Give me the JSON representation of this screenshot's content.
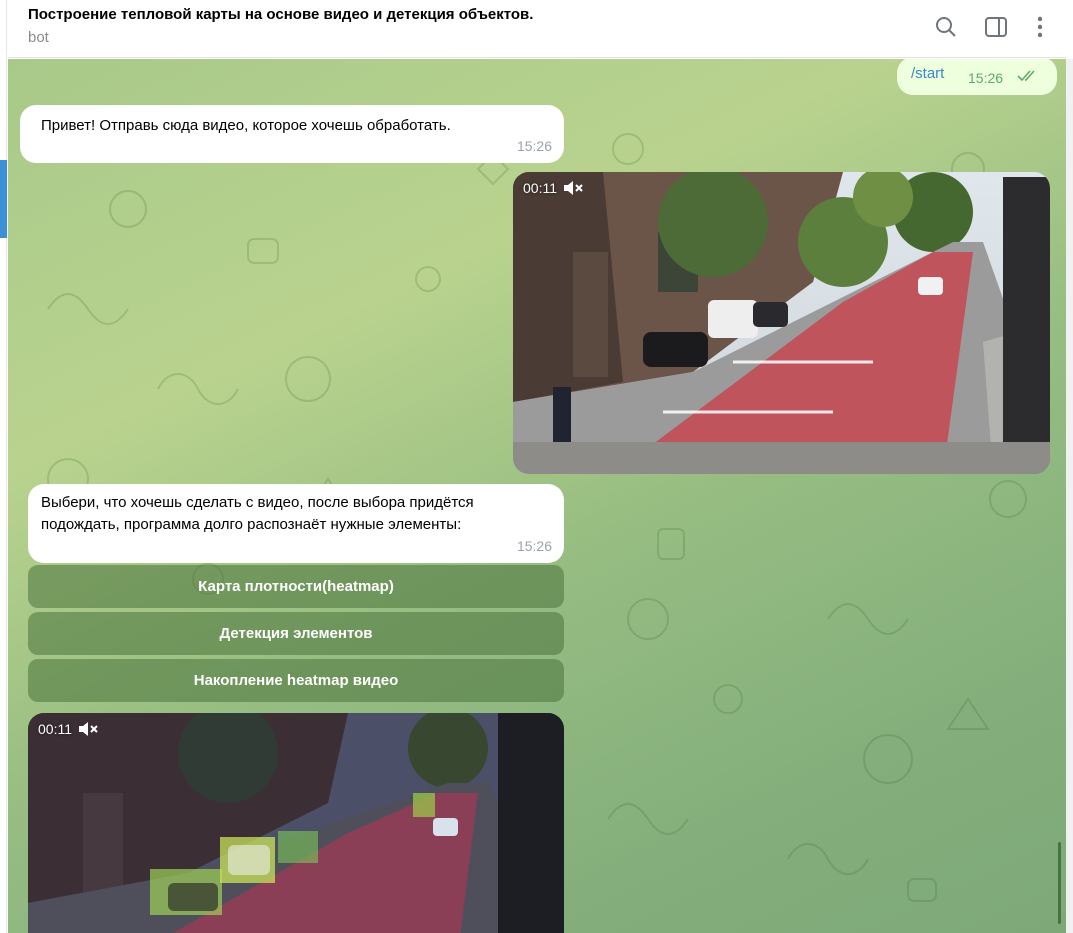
{
  "header": {
    "title": "Построение тепловой карты на основе видео и детекция объектов.",
    "subtitle": "bot",
    "icons": [
      "search-icon",
      "sidebar-toggle-icon",
      "more-vertical-icon"
    ]
  },
  "messages": {
    "start": {
      "text": "/start",
      "time": "15:26"
    },
    "greeting": {
      "text": "Привет! Отправь сюда видео, которое хочешь обработать.",
      "time": "15:26"
    },
    "video1": {
      "duration": "00:11"
    },
    "choose": {
      "line1": "Выбери, что хочешь сделать с видео, после выбора придётся",
      "line2": "подождать, программа долго распознаёт нужные элементы:",
      "time": "15:26"
    },
    "video2": {
      "duration": "00:11"
    }
  },
  "keyboard": {
    "heatmap": "Карта плотности(heatmap)",
    "detection": "Детекция элементов",
    "accumulate": "Накопление heatmap видео"
  },
  "colors": {
    "accent": "#3d8fd6",
    "outgoing_bubble": "#eeffde",
    "check": "#5fa96a"
  }
}
